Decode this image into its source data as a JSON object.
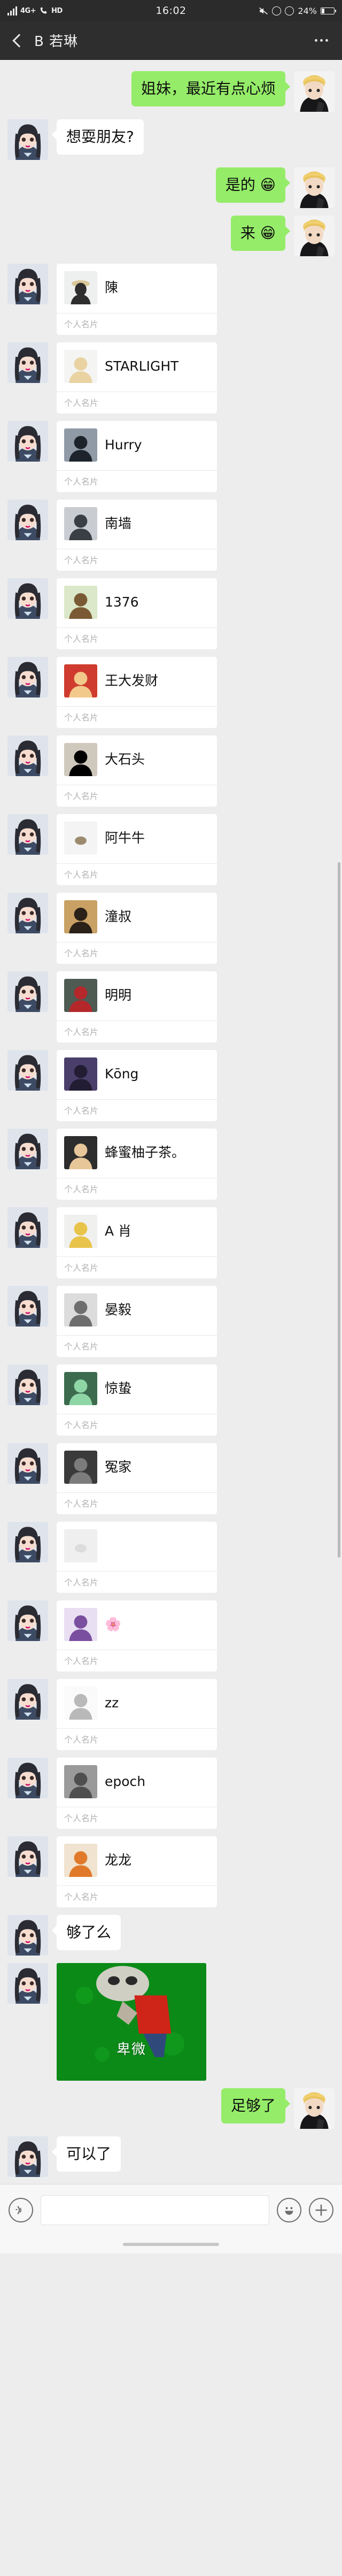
{
  "status_bar": {
    "network_label": "4G+",
    "call_label": "HD",
    "time": "16:02",
    "battery_percent": "24%",
    "icons": [
      "signal-bars-icon",
      "network-4g-icon",
      "hd-call-icon",
      "mute-icon",
      "rotation-lock-icon",
      "alarm-clock-icon",
      "battery-icon"
    ]
  },
  "nav": {
    "back_icon": "back-chevron-icon",
    "title": "B 若琳",
    "more_icon": "more-options-icon"
  },
  "chat": {
    "card_footer_label": "个人名片",
    "messages": [
      {
        "id": "m1",
        "side": "right",
        "type": "text",
        "text": "姐妹，最近有点心烦"
      },
      {
        "id": "m2",
        "side": "left",
        "type": "text",
        "text": "想耍朋友?"
      },
      {
        "id": "m3",
        "side": "right",
        "type": "text",
        "text": "是的 😁"
      },
      {
        "id": "m4",
        "side": "right",
        "type": "text",
        "text": "来 😁"
      },
      {
        "id": "m5",
        "side": "left",
        "type": "card",
        "name": "陳",
        "thumb": "hat-man-photo"
      },
      {
        "id": "m6",
        "side": "left",
        "type": "card",
        "name": "STARLIGHT",
        "thumb": "blond-anime-photo"
      },
      {
        "id": "m7",
        "side": "left",
        "type": "card",
        "name": "Hurry",
        "thumb": "silhouette-sky-photo"
      },
      {
        "id": "m8",
        "side": "left",
        "type": "card",
        "name": "南墙",
        "thumb": "portrait-bw-photo"
      },
      {
        "id": "m9",
        "side": "left",
        "type": "card",
        "name": "1376",
        "thumb": "cartoon-figure-photo"
      },
      {
        "id": "m10",
        "side": "left",
        "type": "card",
        "name": "王大发财",
        "thumb": "red-cartoon-photo"
      },
      {
        "id": "m11",
        "side": "left",
        "type": "card",
        "name": "大石头",
        "thumb": "stone-scene-photo"
      },
      {
        "id": "m12",
        "side": "left",
        "type": "card",
        "name": "阿牛牛",
        "thumb": "small-object-photo"
      },
      {
        "id": "m13",
        "side": "left",
        "type": "card",
        "name": "潼叔",
        "thumb": "young-man-photo"
      },
      {
        "id": "m14",
        "side": "left",
        "type": "card",
        "name": "明明",
        "thumb": "football-player-photo"
      },
      {
        "id": "m15",
        "side": "left",
        "type": "card",
        "name": "Kōng",
        "thumb": "dark-anime-photo"
      },
      {
        "id": "m16",
        "side": "left",
        "type": "card",
        "name": "蜂蜜柚子茶。",
        "thumb": "sunglasses-man-photo"
      },
      {
        "id": "m17",
        "side": "left",
        "type": "card",
        "name": "A 肖",
        "thumb": "yellow-hat-photo"
      },
      {
        "id": "m18",
        "side": "left",
        "type": "card",
        "name": "晏毅",
        "thumb": "grey-figure-photo"
      },
      {
        "id": "m19",
        "side": "left",
        "type": "card",
        "name": "惊蛰",
        "thumb": "green-anime-photo"
      },
      {
        "id": "m20",
        "side": "left",
        "type": "card",
        "name": "冤家",
        "thumb": "dark-portrait-photo"
      },
      {
        "id": "m21",
        "side": "left",
        "type": "card",
        "name": "",
        "thumb": "blank-light-photo"
      },
      {
        "id": "m22",
        "side": "left",
        "type": "card",
        "name": "🌸",
        "thumb": "blossom-photo"
      },
      {
        "id": "m23",
        "side": "left",
        "type": "card",
        "name": "zz",
        "thumb": "white-sketch-photo"
      },
      {
        "id": "m24",
        "side": "left",
        "type": "card",
        "name": "epoch",
        "thumb": "grey-texture-photo"
      },
      {
        "id": "m25",
        "side": "left",
        "type": "card",
        "name": "龙龙",
        "thumb": "orange-cartoon-photo"
      },
      {
        "id": "m26",
        "side": "left",
        "type": "text",
        "text": "够了么"
      },
      {
        "id": "m27",
        "side": "left",
        "type": "sticker",
        "caption": "卑微"
      },
      {
        "id": "m28",
        "side": "right",
        "type": "text",
        "text": "足够了"
      },
      {
        "id": "m29",
        "side": "left",
        "type": "text",
        "text": "可以了"
      }
    ]
  },
  "input_bar": {
    "voice_icon": "voice-input-icon",
    "input_value": "",
    "input_placeholder": "",
    "emoji_icon": "emoji-icon",
    "plus_icon": "more-actions-icon"
  },
  "colors": {
    "outgoing_bubble": "#95ec69",
    "incoming_bubble": "#ffffff",
    "chat_background": "#ededed",
    "navbar": "#2e2e2e",
    "statusbar": "#2b2b2b"
  }
}
